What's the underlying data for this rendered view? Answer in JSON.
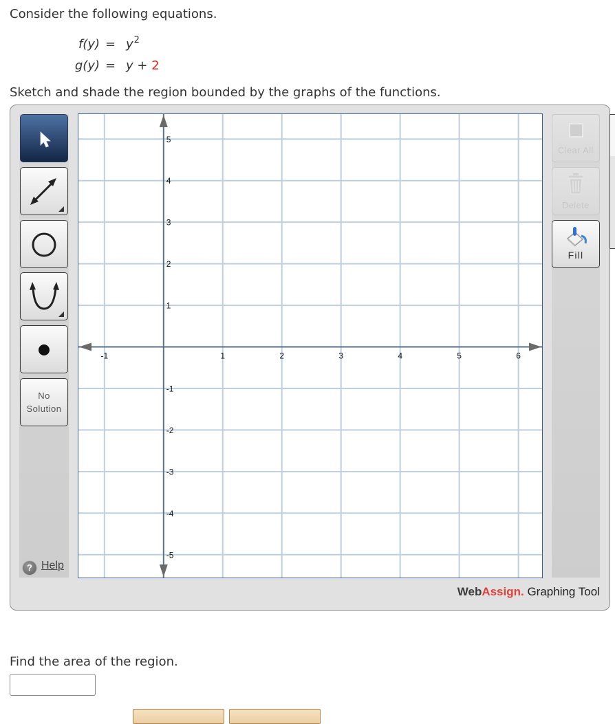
{
  "prompt": {
    "intro": "Consider the following equations.",
    "equations": {
      "f": {
        "lhs": "f(y)",
        "eq": "=",
        "rhs_base": "y",
        "rhs_exp": "2"
      },
      "g": {
        "lhs": "g(y)",
        "eq": "=",
        "rhs_var": "y",
        "rhs_op": " + ",
        "rhs_const": "2"
      }
    },
    "instruction": "Sketch and shade the region bounded by the graphs of the functions."
  },
  "graph_tool": {
    "left_tools": [
      {
        "id": "pointer",
        "icon": "pointer-arrow-icon",
        "selected": true
      },
      {
        "id": "line",
        "icon": "line-tool-icon",
        "has_submenu": true
      },
      {
        "id": "circle",
        "icon": "circle-icon"
      },
      {
        "id": "parabola",
        "icon": "parabola-icon",
        "has_submenu": true
      },
      {
        "id": "point",
        "icon": "point-icon"
      },
      {
        "id": "no-solution",
        "label_line1": "No",
        "label_line2": "Solution"
      }
    ],
    "help_label": "Help",
    "right_tools": [
      {
        "id": "clear-all",
        "label": "Clear All",
        "icon": "clear-all-icon",
        "enabled": false
      },
      {
        "id": "delete",
        "label": "Delete",
        "icon": "trash-icon",
        "enabled": false
      },
      {
        "id": "fill",
        "label": "Fill",
        "icon": "paint-bucket-icon",
        "enabled": true
      }
    ],
    "brand": {
      "web": "Web",
      "assign": "Assign.",
      "product": " Graphing Tool"
    },
    "axes": {
      "x_range": [
        -1.44,
        6.4
      ],
      "y_range": [
        -5.55,
        5.6
      ],
      "x_grid": [
        -1,
        1,
        2,
        3,
        4,
        5,
        6
      ],
      "y_grid": [
        -5,
        -4,
        -3,
        -2,
        -1,
        1,
        2,
        3,
        4,
        5
      ],
      "x_tick_labels": [
        "-1",
        "1",
        "2",
        "3",
        "4",
        "5",
        "6"
      ],
      "y_tick_labels": [
        "-5",
        "-4",
        "-3",
        "-2",
        "-1",
        "1",
        "2",
        "3",
        "4",
        "5"
      ]
    },
    "colors": {
      "grid": "#bfcfdf",
      "axis": "#58718c",
      "arrow": "#6a6a6a",
      "label": "#111111"
    }
  },
  "question": {
    "label": "Find the area of the region.",
    "answer_value": ""
  }
}
